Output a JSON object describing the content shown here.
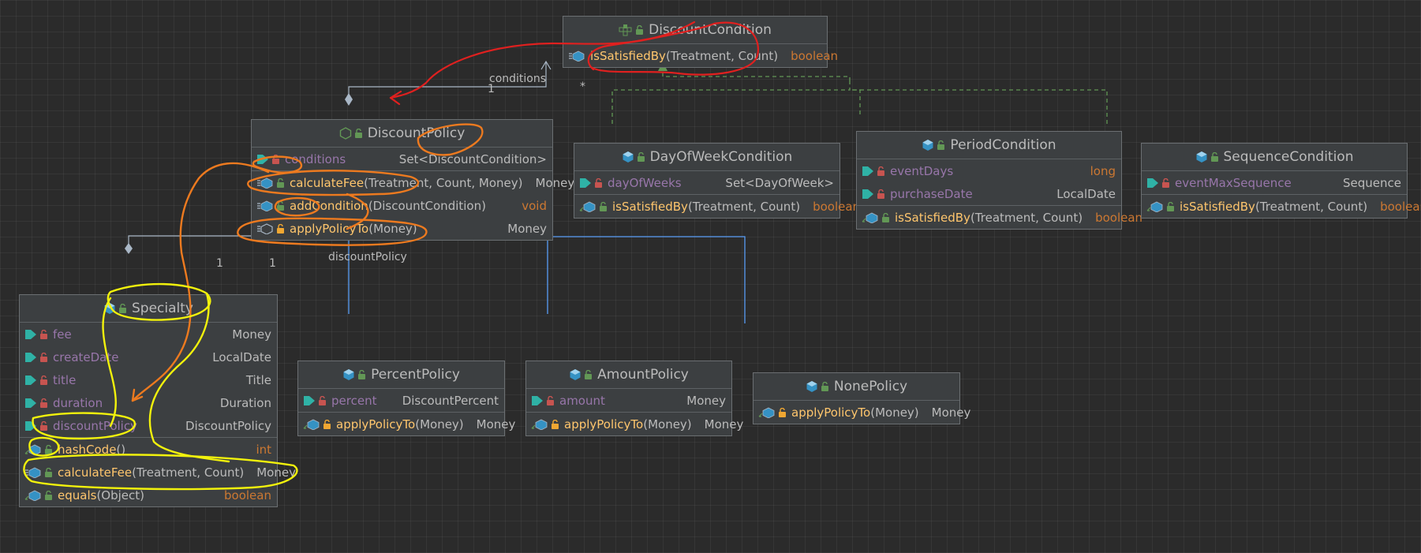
{
  "diagram": {
    "classes": {
      "discount_condition": {
        "name": "DiscountCondition",
        "members": [
          {
            "name": "isSatisfiedBy",
            "params": "(Treatment, Count)",
            "type": "boolean"
          }
        ]
      },
      "discount_policy": {
        "name": "DiscountPolicy",
        "fields": [
          {
            "name": "conditions",
            "type": "Set<DiscountCondition>"
          }
        ],
        "methods": [
          {
            "name": "calculateFee",
            "params": "(Treatment, Count, Money)",
            "type": "Money"
          },
          {
            "name": "addCondition",
            "params": "(DiscountCondition)",
            "type": "void"
          },
          {
            "name": "applyPolicyTo",
            "params": "(Money)",
            "type": "Money"
          }
        ]
      },
      "day_of_week_condition": {
        "name": "DayOfWeekCondition",
        "fields": [
          {
            "name": "dayOfWeeks",
            "type": "Set<DayOfWeek>"
          }
        ],
        "methods": [
          {
            "name": "isSatisfiedBy",
            "params": "(Treatment, Count)",
            "type": "boolean"
          }
        ]
      },
      "period_condition": {
        "name": "PeriodCondition",
        "fields": [
          {
            "name": "eventDays",
            "type": "long"
          },
          {
            "name": "purchaseDate",
            "type": "LocalDate"
          }
        ],
        "methods": [
          {
            "name": "isSatisfiedBy",
            "params": "(Treatment, Count)",
            "type": "boolean"
          }
        ]
      },
      "sequence_condition": {
        "name": "SequenceCondition",
        "fields": [
          {
            "name": "eventMaxSequence",
            "type": "Sequence"
          }
        ],
        "methods": [
          {
            "name": "isSatisfiedBy",
            "params": "(Treatment, Count)",
            "type": "boolean"
          }
        ]
      },
      "specialty": {
        "name": "Specialty",
        "fields": [
          {
            "name": "fee",
            "type": "Money"
          },
          {
            "name": "createDate",
            "type": "LocalDate"
          },
          {
            "name": "title",
            "type": "Title"
          },
          {
            "name": "duration",
            "type": "Duration"
          },
          {
            "name": "discountPolicy",
            "type": "DiscountPolicy"
          }
        ],
        "methods": [
          {
            "name": "hashCode",
            "params": "()",
            "type": "int"
          },
          {
            "name": "calculateFee",
            "params": "(Treatment, Count)",
            "type": "Money"
          },
          {
            "name": "equals",
            "params": "(Object)",
            "type": "boolean"
          }
        ]
      },
      "percent_policy": {
        "name": "PercentPolicy",
        "fields": [
          {
            "name": "percent",
            "type": "DiscountPercent"
          }
        ],
        "methods": [
          {
            "name": "applyPolicyTo",
            "params": "(Money)",
            "type": "Money"
          }
        ]
      },
      "amount_policy": {
        "name": "AmountPolicy",
        "fields": [
          {
            "name": "amount",
            "type": "Money"
          }
        ],
        "methods": [
          {
            "name": "applyPolicyTo",
            "params": "(Money)",
            "type": "Money"
          }
        ]
      },
      "none_policy": {
        "name": "NonePolicy",
        "methods": [
          {
            "name": "applyPolicyTo",
            "params": "(Money)",
            "type": "Money"
          }
        ]
      }
    },
    "edge_labels": {
      "conditions_role": "conditions",
      "conditions_one": "1",
      "conditions_many": "*",
      "policy_role": "discountPolicy",
      "policy_one_left": "1",
      "policy_one_right": "1"
    }
  },
  "colors": {
    "background": "#2b2b2b",
    "association": "#a9b7c6",
    "inheritance": "#589df6",
    "realization": "#629755",
    "annotation_red": "#e0201f",
    "annotation_orange": "#ed7a1f",
    "annotation_yellow": "#f2f20c",
    "field_name": "#9876aa",
    "method_name": "#ffc66d",
    "keyword_type": "#cc7832"
  }
}
